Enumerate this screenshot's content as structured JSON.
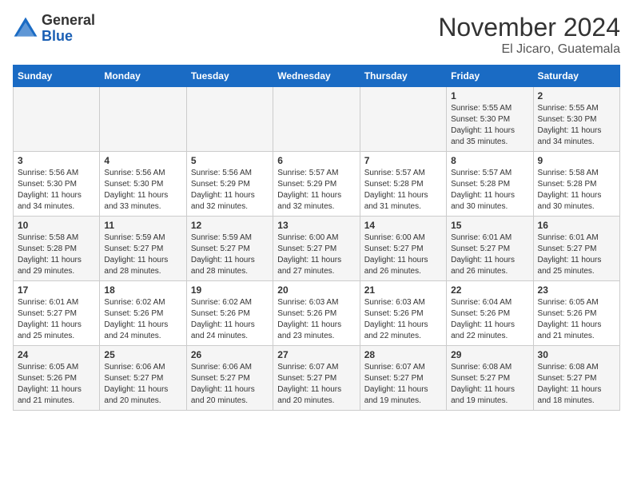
{
  "header": {
    "logo": {
      "general": "General",
      "blue": "Blue"
    },
    "title": "November 2024",
    "subtitle": "El Jicaro, Guatemala"
  },
  "calendar": {
    "days_of_week": [
      "Sunday",
      "Monday",
      "Tuesday",
      "Wednesday",
      "Thursday",
      "Friday",
      "Saturday"
    ],
    "weeks": [
      [
        {
          "day": "",
          "info": ""
        },
        {
          "day": "",
          "info": ""
        },
        {
          "day": "",
          "info": ""
        },
        {
          "day": "",
          "info": ""
        },
        {
          "day": "",
          "info": ""
        },
        {
          "day": "1",
          "info": "Sunrise: 5:55 AM\nSunset: 5:30 PM\nDaylight: 11 hours and 35 minutes."
        },
        {
          "day": "2",
          "info": "Sunrise: 5:55 AM\nSunset: 5:30 PM\nDaylight: 11 hours and 34 minutes."
        }
      ],
      [
        {
          "day": "3",
          "info": "Sunrise: 5:56 AM\nSunset: 5:30 PM\nDaylight: 11 hours and 34 minutes."
        },
        {
          "day": "4",
          "info": "Sunrise: 5:56 AM\nSunset: 5:30 PM\nDaylight: 11 hours and 33 minutes."
        },
        {
          "day": "5",
          "info": "Sunrise: 5:56 AM\nSunset: 5:29 PM\nDaylight: 11 hours and 32 minutes."
        },
        {
          "day": "6",
          "info": "Sunrise: 5:57 AM\nSunset: 5:29 PM\nDaylight: 11 hours and 32 minutes."
        },
        {
          "day": "7",
          "info": "Sunrise: 5:57 AM\nSunset: 5:28 PM\nDaylight: 11 hours and 31 minutes."
        },
        {
          "day": "8",
          "info": "Sunrise: 5:57 AM\nSunset: 5:28 PM\nDaylight: 11 hours and 30 minutes."
        },
        {
          "day": "9",
          "info": "Sunrise: 5:58 AM\nSunset: 5:28 PM\nDaylight: 11 hours and 30 minutes."
        }
      ],
      [
        {
          "day": "10",
          "info": "Sunrise: 5:58 AM\nSunset: 5:28 PM\nDaylight: 11 hours and 29 minutes."
        },
        {
          "day": "11",
          "info": "Sunrise: 5:59 AM\nSunset: 5:27 PM\nDaylight: 11 hours and 28 minutes."
        },
        {
          "day": "12",
          "info": "Sunrise: 5:59 AM\nSunset: 5:27 PM\nDaylight: 11 hours and 28 minutes."
        },
        {
          "day": "13",
          "info": "Sunrise: 6:00 AM\nSunset: 5:27 PM\nDaylight: 11 hours and 27 minutes."
        },
        {
          "day": "14",
          "info": "Sunrise: 6:00 AM\nSunset: 5:27 PM\nDaylight: 11 hours and 26 minutes."
        },
        {
          "day": "15",
          "info": "Sunrise: 6:01 AM\nSunset: 5:27 PM\nDaylight: 11 hours and 26 minutes."
        },
        {
          "day": "16",
          "info": "Sunrise: 6:01 AM\nSunset: 5:27 PM\nDaylight: 11 hours and 25 minutes."
        }
      ],
      [
        {
          "day": "17",
          "info": "Sunrise: 6:01 AM\nSunset: 5:27 PM\nDaylight: 11 hours and 25 minutes."
        },
        {
          "day": "18",
          "info": "Sunrise: 6:02 AM\nSunset: 5:26 PM\nDaylight: 11 hours and 24 minutes."
        },
        {
          "day": "19",
          "info": "Sunrise: 6:02 AM\nSunset: 5:26 PM\nDaylight: 11 hours and 24 minutes."
        },
        {
          "day": "20",
          "info": "Sunrise: 6:03 AM\nSunset: 5:26 PM\nDaylight: 11 hours and 23 minutes."
        },
        {
          "day": "21",
          "info": "Sunrise: 6:03 AM\nSunset: 5:26 PM\nDaylight: 11 hours and 22 minutes."
        },
        {
          "day": "22",
          "info": "Sunrise: 6:04 AM\nSunset: 5:26 PM\nDaylight: 11 hours and 22 minutes."
        },
        {
          "day": "23",
          "info": "Sunrise: 6:05 AM\nSunset: 5:26 PM\nDaylight: 11 hours and 21 minutes."
        }
      ],
      [
        {
          "day": "24",
          "info": "Sunrise: 6:05 AM\nSunset: 5:26 PM\nDaylight: 11 hours and 21 minutes."
        },
        {
          "day": "25",
          "info": "Sunrise: 6:06 AM\nSunset: 5:27 PM\nDaylight: 11 hours and 20 minutes."
        },
        {
          "day": "26",
          "info": "Sunrise: 6:06 AM\nSunset: 5:27 PM\nDaylight: 11 hours and 20 minutes."
        },
        {
          "day": "27",
          "info": "Sunrise: 6:07 AM\nSunset: 5:27 PM\nDaylight: 11 hours and 20 minutes."
        },
        {
          "day": "28",
          "info": "Sunrise: 6:07 AM\nSunset: 5:27 PM\nDaylight: 11 hours and 19 minutes."
        },
        {
          "day": "29",
          "info": "Sunrise: 6:08 AM\nSunset: 5:27 PM\nDaylight: 11 hours and 19 minutes."
        },
        {
          "day": "30",
          "info": "Sunrise: 6:08 AM\nSunset: 5:27 PM\nDaylight: 11 hours and 18 minutes."
        }
      ]
    ]
  }
}
